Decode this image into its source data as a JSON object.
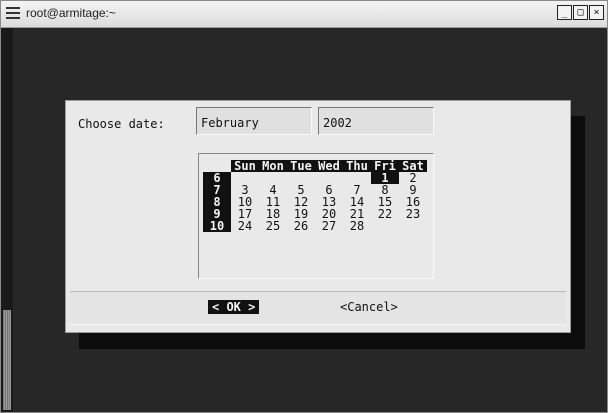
{
  "window": {
    "title": "root@armitage:~",
    "min_glyph": "_",
    "max_glyph": "□",
    "close_glyph": "×"
  },
  "dialog": {
    "label": "Choose date:",
    "month": "February",
    "year": "2002",
    "calendar": {
      "headers": [
        "Sun",
        "Mon",
        "Tue",
        "Wed",
        "Thu",
        "Fri",
        "Sat"
      ],
      "weeks": [
        {
          "week": "6",
          "days": [
            "",
            "",
            "",
            "",
            "",
            "1",
            "2"
          ]
        },
        {
          "week": "7",
          "days": [
            "3",
            "4",
            "5",
            "6",
            "7",
            "8",
            "9"
          ]
        },
        {
          "week": "8",
          "days": [
            "10",
            "11",
            "12",
            "13",
            "14",
            "15",
            "16"
          ]
        },
        {
          "week": "9",
          "days": [
            "17",
            "18",
            "19",
            "20",
            "21",
            "22",
            "23"
          ]
        },
        {
          "week": "10",
          "days": [
            "24",
            "25",
            "26",
            "27",
            "28",
            "",
            ""
          ]
        }
      ],
      "selected_day": "1"
    },
    "ok_label": "< OK >",
    "cancel_label": "<Cancel>"
  }
}
